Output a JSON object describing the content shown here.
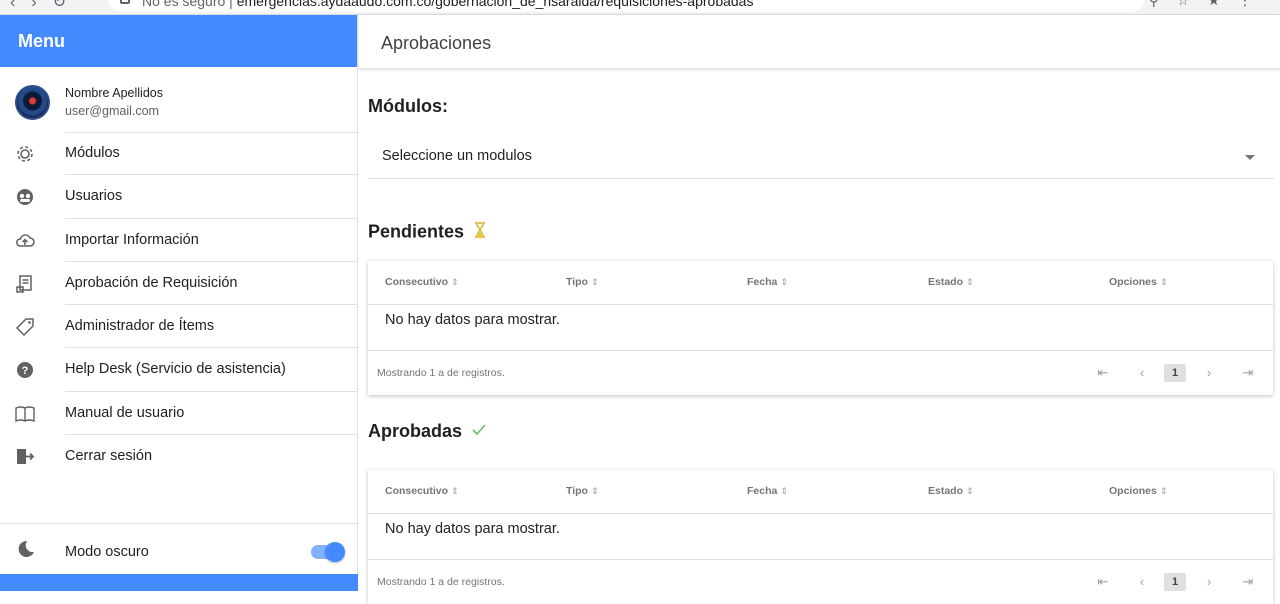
{
  "browser": {
    "url_prefix": "No es seguro",
    "url": "emergencias.aydaaudo.com.co/gobernacion_de_risaralda/requisiciones-aprobadas"
  },
  "sidebar": {
    "title": "Menu",
    "user": {
      "name": "Nombre Apellidos",
      "email": "user@gmail.com"
    },
    "items": [
      {
        "label": "Módulos",
        "icon": "gear-icon"
      },
      {
        "label": "Usuarios",
        "icon": "users-icon"
      },
      {
        "label": "Importar Información",
        "icon": "cloud-upload-icon"
      },
      {
        "label": "Aprobación de Requisición",
        "icon": "receipt-icon"
      },
      {
        "label": "Administrador de Ítems",
        "icon": "tag-icon"
      },
      {
        "label": "Help Desk (Servicio de asistencia)",
        "icon": "help-icon"
      },
      {
        "label": "Manual de usuario",
        "icon": "book-icon"
      },
      {
        "label": "Cerrar sesión",
        "icon": "logout-icon"
      }
    ],
    "dark_mode": {
      "label": "Modo oscuro",
      "enabled": true,
      "icon": "moon-icon"
    },
    "accent_color": "#448aff"
  },
  "main": {
    "title": "Aprobaciones",
    "modules_label": "Módulos:",
    "select_value": "Seleccione un modulos",
    "pending": {
      "title": "Pendientes",
      "icon": "hourglass-icon",
      "columns": [
        "Consecutivo",
        "Tipo",
        "Fecha",
        "Estado",
        "Opciones"
      ],
      "empty": "No hay datos para mostrar.",
      "footer": "Mostrando 1 a de registros.",
      "page": "1"
    },
    "approved": {
      "title": "Aprobadas",
      "icon": "check-icon",
      "columns": [
        "Consecutivo",
        "Tipo",
        "Fecha",
        "Estado",
        "Opciones"
      ],
      "empty": "No hay datos para mostrar.",
      "footer": "Mostrando 1 a de registros.",
      "page": "1"
    }
  }
}
